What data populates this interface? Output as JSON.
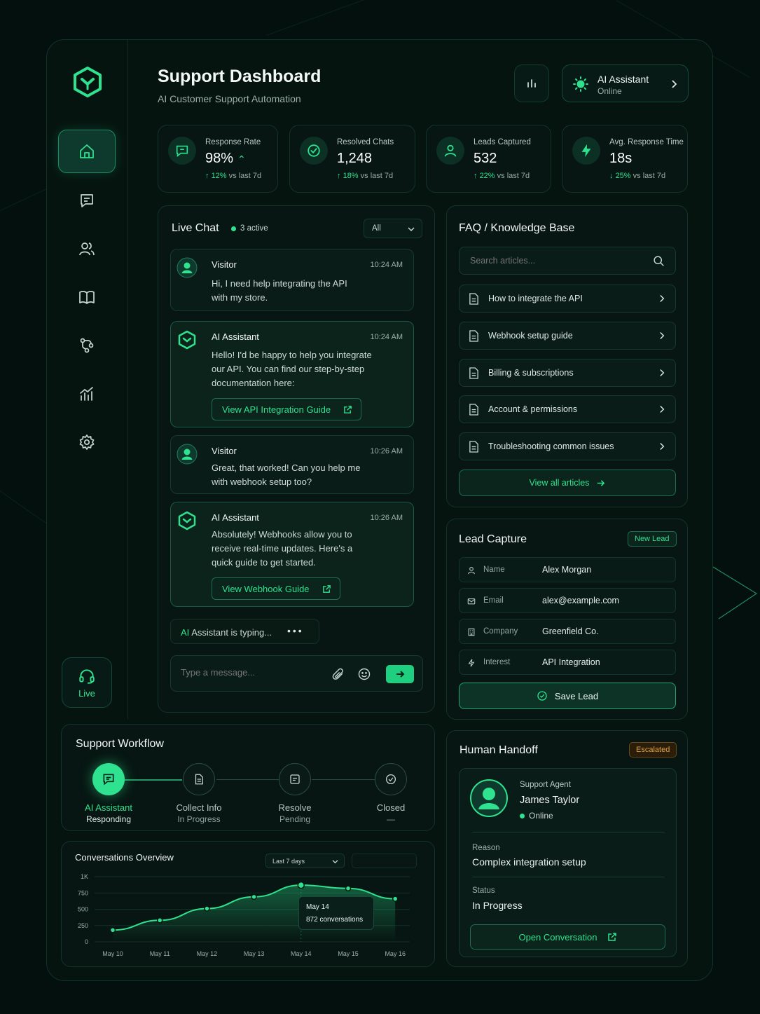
{
  "header": {
    "title": "Support Dashboard",
    "subtitle": "AI Customer Support Automation",
    "assistant_name": "AI Assistant",
    "assistant_status": "Online"
  },
  "sidebar": {
    "items": [
      {
        "name": "home",
        "icon": "home-icon",
        "active": true
      },
      {
        "name": "chats",
        "icon": "chat-icon",
        "active": false
      },
      {
        "name": "users",
        "icon": "users-icon",
        "active": false
      },
      {
        "name": "knowledge",
        "icon": "book-icon",
        "active": false
      },
      {
        "name": "workflow",
        "icon": "workflow-icon",
        "active": false
      },
      {
        "name": "analytics",
        "icon": "analytics-icon",
        "active": false
      },
      {
        "name": "settings",
        "icon": "gear-icon",
        "active": false
      }
    ],
    "live_label": "Live"
  },
  "stats": [
    {
      "label": "Response Rate",
      "value": "98%",
      "change": "12%",
      "change_suffix": " vs last 7d",
      "direction": "up",
      "icon": "chat-bubble-icon"
    },
    {
      "label": "Resolved Chats",
      "value": "1,248",
      "change": "18%",
      "change_suffix": " vs last 7d",
      "direction": "up",
      "icon": "check-circle-icon"
    },
    {
      "label": "Leads Captured",
      "value": "532",
      "change": "22%",
      "change_suffix": " vs last 7d",
      "direction": "up",
      "icon": "user-icon"
    },
    {
      "label": "Avg. Response Time",
      "value": "18s",
      "change": "25%",
      "change_suffix": " vs last 7d",
      "direction": "down",
      "icon": "bolt-icon"
    }
  ],
  "live_chat": {
    "title": "Live Chat",
    "active": "3 active",
    "filter": "All",
    "messages": [
      {
        "sender": "Visitor",
        "time": "10:24 AM",
        "text": "Hi, I need help integrating the API with my store."
      },
      {
        "sender": "AI Assistant",
        "time": "10:24 AM",
        "text": "Hello! I'd be happy to help you integrate our API. You can find our step-by-step documentation here:",
        "link": "View API Integration Guide"
      },
      {
        "sender": "Visitor",
        "time": "10:26 AM",
        "text": "Great, that worked! Can you help me with webhook setup too?"
      },
      {
        "sender": "AI Assistant",
        "time": "10:26 AM",
        "text": "Absolutely! Webhooks allow you to receive real-time updates. Here's a quick guide to get started.",
        "link": "View Webhook Guide"
      }
    ],
    "typing_name": "AI",
    "typing_rest": " Assistant is typing...",
    "input_placeholder": "Type a message..."
  },
  "faq": {
    "title": "FAQ / Knowledge Base",
    "search_placeholder": "Search articles...",
    "articles": [
      "How to integrate the API",
      "Webhook setup guide",
      "Billing & subscriptions",
      "Account & permissions",
      "Troubleshooting common issues"
    ],
    "view_all": "View all articles"
  },
  "lead": {
    "title": "Lead Capture",
    "badge": "New Lead",
    "fields": [
      {
        "label": "Name",
        "value": "Alex Morgan",
        "icon": "user-icon"
      },
      {
        "label": "Email",
        "value": "alex@example.com",
        "icon": "mail-icon"
      },
      {
        "label": "Company",
        "value": "Greenfield Co.",
        "icon": "building-icon"
      },
      {
        "label": "Interest",
        "value": "API Integration",
        "icon": "bolt-icon"
      }
    ],
    "save": "Save Lead"
  },
  "workflow": {
    "title": "Support Workflow",
    "steps": [
      {
        "label": "AI Assistant",
        "status": "Responding",
        "active": true
      },
      {
        "label": "Collect Info",
        "status": "In Progress",
        "active": false
      },
      {
        "label": "Resolve",
        "status": "Pending",
        "active": false
      },
      {
        "label": "Closed",
        "status": "—",
        "active": false
      }
    ]
  },
  "chart": {
    "title": "Conversations Overview",
    "range": "Last 7 days",
    "tooltip_date": "May 14",
    "tooltip_value": "872 conversations"
  },
  "chart_data": {
    "type": "area",
    "title": "Conversations Overview",
    "x": [
      "May 10",
      "May 11",
      "May 12",
      "May 13",
      "May 14",
      "May 15",
      "May 16"
    ],
    "series": [
      {
        "values": [
          180,
          330,
          510,
          690,
          870,
          820,
          660
        ]
      }
    ],
    "yticks": [
      "0",
      "250",
      "500",
      "750",
      "1K"
    ],
    "ylim": [
      0,
      1000
    ]
  },
  "handoff": {
    "title": "Human Handoff",
    "badge": "Escalated",
    "role": "Support Agent",
    "agent": "James Taylor",
    "agent_status": "Online",
    "reason_label": "Reason",
    "reason": "Complex integration setup",
    "status_label": "Status",
    "status": "In Progress",
    "open": "Open Conversation"
  },
  "colors": {
    "accent": "#2ee28f",
    "background": "#04100d",
    "card": "#071612",
    "warning": "#e0a13a"
  }
}
